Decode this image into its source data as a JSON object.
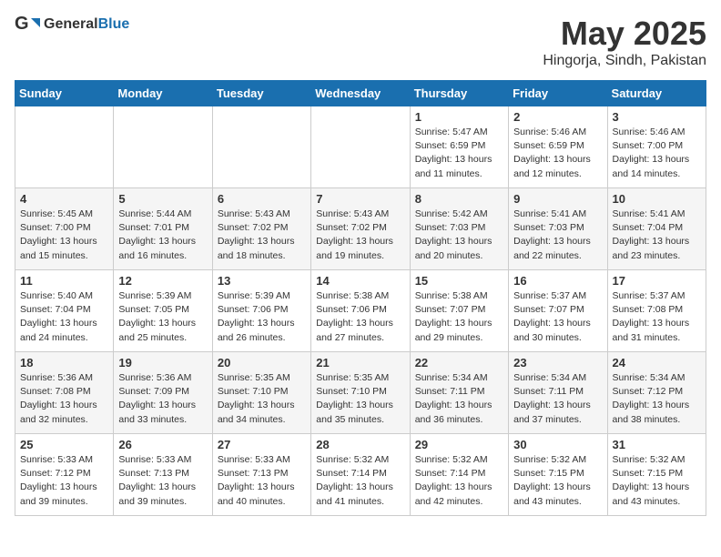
{
  "logo": {
    "general": "General",
    "blue": "Blue"
  },
  "title": "May 2025",
  "location": "Hingorja, Sindh, Pakistan",
  "days_of_week": [
    "Sunday",
    "Monday",
    "Tuesday",
    "Wednesday",
    "Thursday",
    "Friday",
    "Saturday"
  ],
  "weeks": [
    [
      {
        "day": "",
        "info": ""
      },
      {
        "day": "",
        "info": ""
      },
      {
        "day": "",
        "info": ""
      },
      {
        "day": "",
        "info": ""
      },
      {
        "day": "1",
        "info": "Sunrise: 5:47 AM\nSunset: 6:59 PM\nDaylight: 13 hours\nand 11 minutes."
      },
      {
        "day": "2",
        "info": "Sunrise: 5:46 AM\nSunset: 6:59 PM\nDaylight: 13 hours\nand 12 minutes."
      },
      {
        "day": "3",
        "info": "Sunrise: 5:46 AM\nSunset: 7:00 PM\nDaylight: 13 hours\nand 14 minutes."
      }
    ],
    [
      {
        "day": "4",
        "info": "Sunrise: 5:45 AM\nSunset: 7:00 PM\nDaylight: 13 hours\nand 15 minutes."
      },
      {
        "day": "5",
        "info": "Sunrise: 5:44 AM\nSunset: 7:01 PM\nDaylight: 13 hours\nand 16 minutes."
      },
      {
        "day": "6",
        "info": "Sunrise: 5:43 AM\nSunset: 7:02 PM\nDaylight: 13 hours\nand 18 minutes."
      },
      {
        "day": "7",
        "info": "Sunrise: 5:43 AM\nSunset: 7:02 PM\nDaylight: 13 hours\nand 19 minutes."
      },
      {
        "day": "8",
        "info": "Sunrise: 5:42 AM\nSunset: 7:03 PM\nDaylight: 13 hours\nand 20 minutes."
      },
      {
        "day": "9",
        "info": "Sunrise: 5:41 AM\nSunset: 7:03 PM\nDaylight: 13 hours\nand 22 minutes."
      },
      {
        "day": "10",
        "info": "Sunrise: 5:41 AM\nSunset: 7:04 PM\nDaylight: 13 hours\nand 23 minutes."
      }
    ],
    [
      {
        "day": "11",
        "info": "Sunrise: 5:40 AM\nSunset: 7:04 PM\nDaylight: 13 hours\nand 24 minutes."
      },
      {
        "day": "12",
        "info": "Sunrise: 5:39 AM\nSunset: 7:05 PM\nDaylight: 13 hours\nand 25 minutes."
      },
      {
        "day": "13",
        "info": "Sunrise: 5:39 AM\nSunset: 7:06 PM\nDaylight: 13 hours\nand 26 minutes."
      },
      {
        "day": "14",
        "info": "Sunrise: 5:38 AM\nSunset: 7:06 PM\nDaylight: 13 hours\nand 27 minutes."
      },
      {
        "day": "15",
        "info": "Sunrise: 5:38 AM\nSunset: 7:07 PM\nDaylight: 13 hours\nand 29 minutes."
      },
      {
        "day": "16",
        "info": "Sunrise: 5:37 AM\nSunset: 7:07 PM\nDaylight: 13 hours\nand 30 minutes."
      },
      {
        "day": "17",
        "info": "Sunrise: 5:37 AM\nSunset: 7:08 PM\nDaylight: 13 hours\nand 31 minutes."
      }
    ],
    [
      {
        "day": "18",
        "info": "Sunrise: 5:36 AM\nSunset: 7:08 PM\nDaylight: 13 hours\nand 32 minutes."
      },
      {
        "day": "19",
        "info": "Sunrise: 5:36 AM\nSunset: 7:09 PM\nDaylight: 13 hours\nand 33 minutes."
      },
      {
        "day": "20",
        "info": "Sunrise: 5:35 AM\nSunset: 7:10 PM\nDaylight: 13 hours\nand 34 minutes."
      },
      {
        "day": "21",
        "info": "Sunrise: 5:35 AM\nSunset: 7:10 PM\nDaylight: 13 hours\nand 35 minutes."
      },
      {
        "day": "22",
        "info": "Sunrise: 5:34 AM\nSunset: 7:11 PM\nDaylight: 13 hours\nand 36 minutes."
      },
      {
        "day": "23",
        "info": "Sunrise: 5:34 AM\nSunset: 7:11 PM\nDaylight: 13 hours\nand 37 minutes."
      },
      {
        "day": "24",
        "info": "Sunrise: 5:34 AM\nSunset: 7:12 PM\nDaylight: 13 hours\nand 38 minutes."
      }
    ],
    [
      {
        "day": "25",
        "info": "Sunrise: 5:33 AM\nSunset: 7:12 PM\nDaylight: 13 hours\nand 39 minutes."
      },
      {
        "day": "26",
        "info": "Sunrise: 5:33 AM\nSunset: 7:13 PM\nDaylight: 13 hours\nand 39 minutes."
      },
      {
        "day": "27",
        "info": "Sunrise: 5:33 AM\nSunset: 7:13 PM\nDaylight: 13 hours\nand 40 minutes."
      },
      {
        "day": "28",
        "info": "Sunrise: 5:32 AM\nSunset: 7:14 PM\nDaylight: 13 hours\nand 41 minutes."
      },
      {
        "day": "29",
        "info": "Sunrise: 5:32 AM\nSunset: 7:14 PM\nDaylight: 13 hours\nand 42 minutes."
      },
      {
        "day": "30",
        "info": "Sunrise: 5:32 AM\nSunset: 7:15 PM\nDaylight: 13 hours\nand 43 minutes."
      },
      {
        "day": "31",
        "info": "Sunrise: 5:32 AM\nSunset: 7:15 PM\nDaylight: 13 hours\nand 43 minutes."
      }
    ]
  ]
}
